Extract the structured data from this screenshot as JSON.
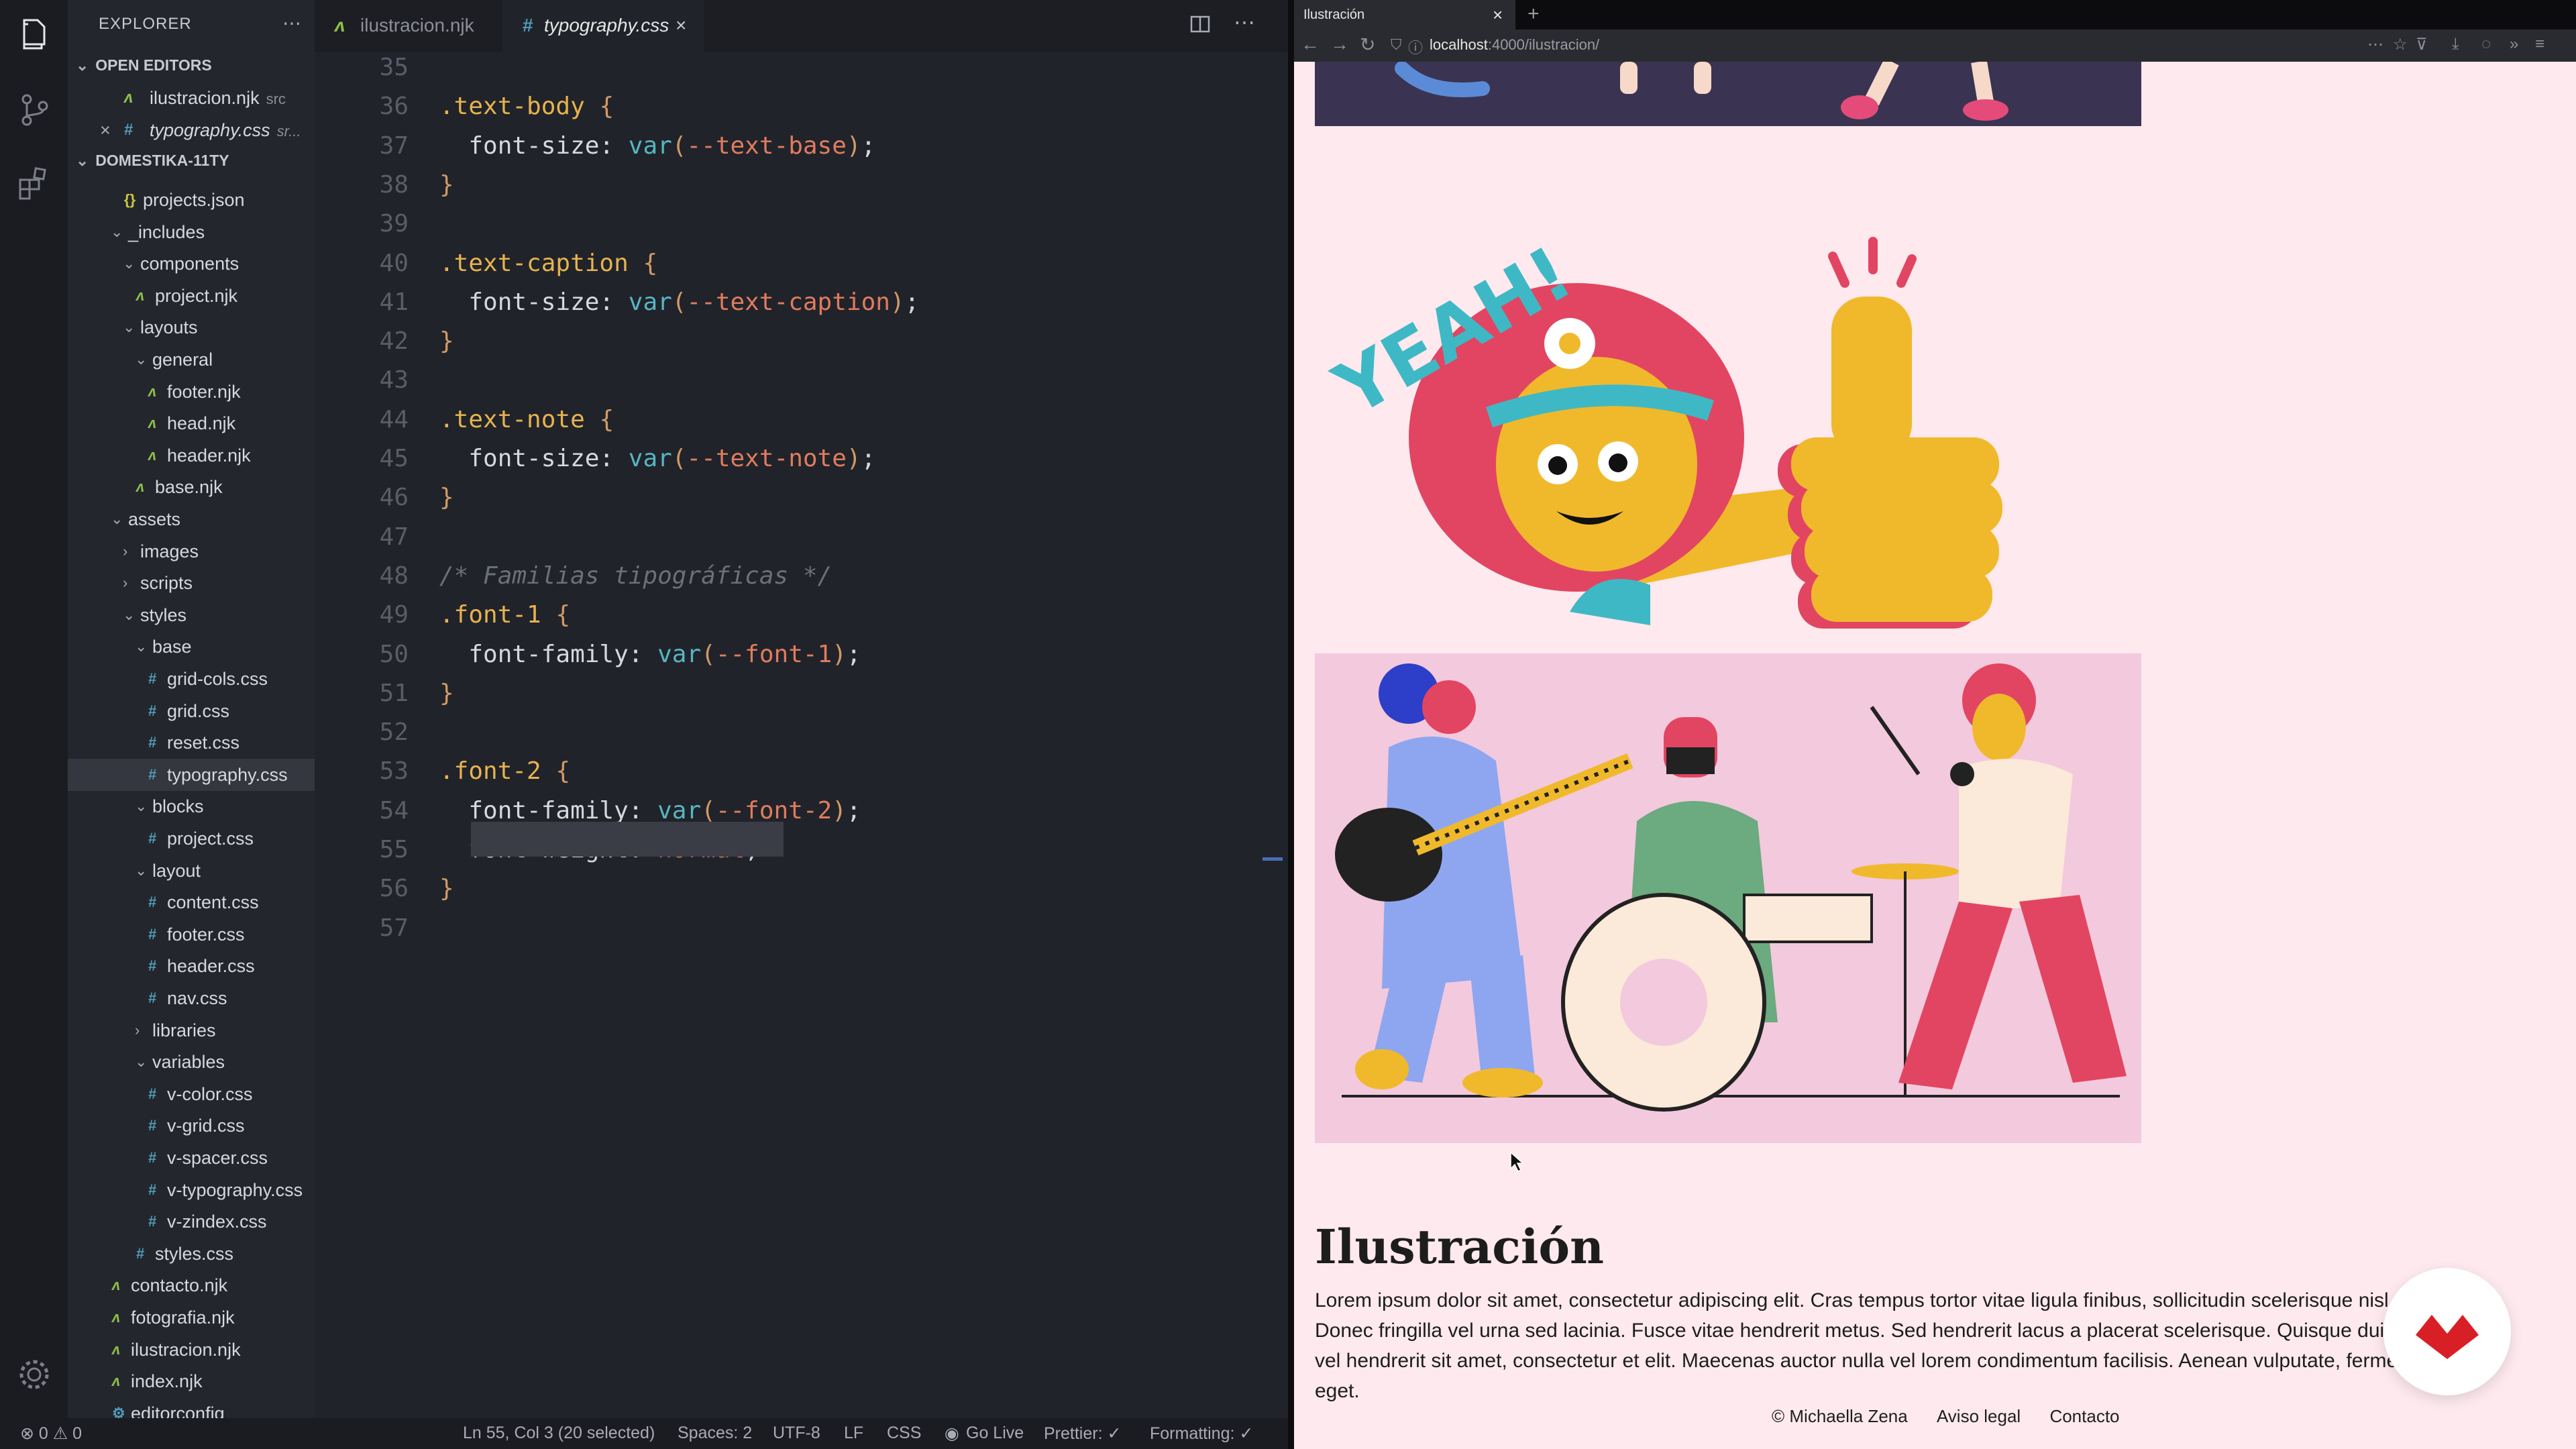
{
  "explorer": {
    "title": "EXPLORER",
    "open_editors_label": "OPEN EDITORS",
    "open_editors": [
      {
        "name": "ilustracion.njk",
        "hint": "src",
        "type": "njk",
        "modified": false
      },
      {
        "name": "typography.css",
        "hint": "sr...",
        "type": "css",
        "modified": true
      }
    ],
    "project_label": "DOMESTIKA-11TY",
    "tree": [
      {
        "name": "projects.json",
        "type": "json",
        "depth": 2
      },
      {
        "name": "_includes",
        "type": "folder-open",
        "depth": 1
      },
      {
        "name": "components",
        "type": "folder-open",
        "depth": 2
      },
      {
        "name": "project.njk",
        "type": "njk",
        "depth": 3
      },
      {
        "name": "layouts",
        "type": "folder-open",
        "depth": 2
      },
      {
        "name": "general",
        "type": "folder-open",
        "depth": 3
      },
      {
        "name": "footer.njk",
        "type": "njk",
        "depth": 4
      },
      {
        "name": "head.njk",
        "type": "njk",
        "depth": 4
      },
      {
        "name": "header.njk",
        "type": "njk",
        "depth": 4
      },
      {
        "name": "base.njk",
        "type": "njk",
        "depth": 3
      },
      {
        "name": "assets",
        "type": "folder-open",
        "depth": 1
      },
      {
        "name": "images",
        "type": "folder-closed",
        "depth": 2
      },
      {
        "name": "scripts",
        "type": "folder-closed",
        "depth": 2
      },
      {
        "name": "styles",
        "type": "folder-open",
        "depth": 2
      },
      {
        "name": "base",
        "type": "folder-open",
        "depth": 3
      },
      {
        "name": "grid-cols.css",
        "type": "css",
        "depth": 4
      },
      {
        "name": "grid.css",
        "type": "css",
        "depth": 4
      },
      {
        "name": "reset.css",
        "type": "css",
        "depth": 4
      },
      {
        "name": "typography.css",
        "type": "css",
        "depth": 4,
        "selected": true
      },
      {
        "name": "blocks",
        "type": "folder-open",
        "depth": 3
      },
      {
        "name": "project.css",
        "type": "css",
        "depth": 4
      },
      {
        "name": "layout",
        "type": "folder-open",
        "depth": 3
      },
      {
        "name": "content.css",
        "type": "css",
        "depth": 4
      },
      {
        "name": "footer.css",
        "type": "css",
        "depth": 4
      },
      {
        "name": "header.css",
        "type": "css",
        "depth": 4
      },
      {
        "name": "nav.css",
        "type": "css",
        "depth": 4
      },
      {
        "name": "libraries",
        "type": "folder-closed",
        "depth": 3
      },
      {
        "name": "variables",
        "type": "folder-open",
        "depth": 3
      },
      {
        "name": "v-color.css",
        "type": "css",
        "depth": 4
      },
      {
        "name": "v-grid.css",
        "type": "css",
        "depth": 4
      },
      {
        "name": "v-spacer.css",
        "type": "css",
        "depth": 4
      },
      {
        "name": "v-typography.css",
        "type": "css",
        "depth": 4
      },
      {
        "name": "v-zindex.css",
        "type": "css",
        "depth": 4
      },
      {
        "name": "styles.css",
        "type": "css",
        "depth": 3
      },
      {
        "name": "contacto.njk",
        "type": "njk",
        "depth": 1
      },
      {
        "name": "fotografia.njk",
        "type": "njk",
        "depth": 1
      },
      {
        "name": "ilustracion.njk",
        "type": "njk",
        "depth": 1
      },
      {
        "name": "index.njk",
        "type": "njk",
        "depth": 1
      },
      {
        "name": "editorconfig",
        "type": "config",
        "depth": 1
      }
    ]
  },
  "tabs": [
    {
      "name": "ilustracion.njk",
      "type": "njk",
      "active": false
    },
    {
      "name": "typography.css",
      "type": "css",
      "active": true
    }
  ],
  "editor": {
    "lines": [
      {
        "n": "35",
        "text": ""
      },
      {
        "n": "36",
        "text": ".text-body {"
      },
      {
        "n": "37",
        "text": "  font-size: var(--text-base);"
      },
      {
        "n": "38",
        "text": "}"
      },
      {
        "n": "39",
        "text": ""
      },
      {
        "n": "40",
        "text": ".text-caption {"
      },
      {
        "n": "41",
        "text": "  font-size: var(--text-caption);"
      },
      {
        "n": "42",
        "text": "}"
      },
      {
        "n": "43",
        "text": ""
      },
      {
        "n": "44",
        "text": ".text-note {"
      },
      {
        "n": "45",
        "text": "  font-size: var(--text-note);"
      },
      {
        "n": "46",
        "text": "}"
      },
      {
        "n": "47",
        "text": ""
      },
      {
        "n": "48",
        "text": "/* Familias tipográficas */"
      },
      {
        "n": "49",
        "text": ".font-1 {"
      },
      {
        "n": "50",
        "text": "  font-family: var(--font-1);"
      },
      {
        "n": "51",
        "text": "}"
      },
      {
        "n": "52",
        "text": ""
      },
      {
        "n": "53",
        "text": ".font-2 {"
      },
      {
        "n": "54",
        "text": "  font-family: var(--font-2);"
      },
      {
        "n": "55",
        "text": "  font-weight: normal;"
      },
      {
        "n": "56",
        "text": "}"
      },
      {
        "n": "57",
        "text": ""
      }
    ]
  },
  "statusbar": {
    "problems": "⊗ 0 ⚠ 0",
    "cursor": "Ln 55, Col 3 (20 selected)",
    "spaces": "Spaces: 2",
    "encoding": "UTF-8",
    "eol": "LF",
    "language": "CSS",
    "golive": "Go Live",
    "prettier": "Prettier: ✓",
    "formatting": "Formatting: ✓"
  },
  "browser": {
    "tab_title": "Ilustración",
    "url_host": "localhost",
    "url_rest": ":4000/ilustracion/",
    "heading": "Ilustración",
    "body": "Lorem ipsum dolor sit amet, consectetur adipiscing elit. Cras tempus tortor vitae ligula finibus, sollicitudin scelerisque nisl varius. Donec fringilla vel urna sed lacinia. Fusce vitae hendrerit metus. Sed hendrerit lacus a placerat scelerisque. Quisque dui scelerisque vel hendrerit sit amet, consectetur et elit. Maecenas auctor nulla vel lorem condimentum facilisis. Aenean vulputate, fermentum ligula eget.",
    "footer": {
      "copyright": "© Michaella Zena",
      "legal": "Aviso legal",
      "contact": "Contacto"
    },
    "illustration_text": "YEAH!"
  },
  "colors": {
    "page_bg": "#fde9ee",
    "accent_red": "#d62b3c",
    "pink_panel": "#f3c9dd"
  }
}
